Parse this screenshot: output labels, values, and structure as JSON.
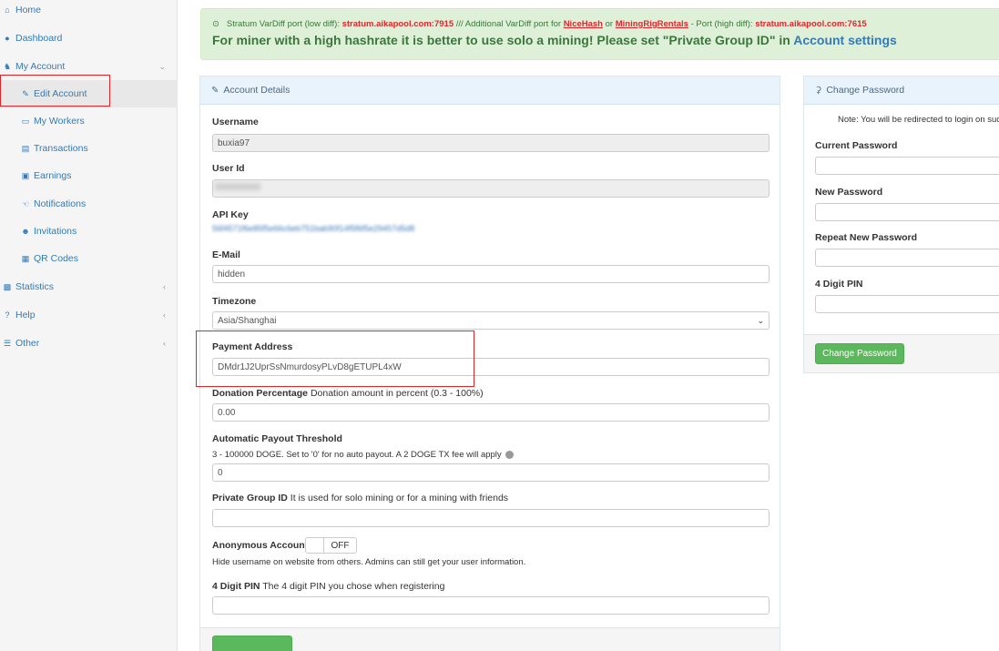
{
  "sidebar": {
    "home": "Home",
    "dashboard": "Dashboard",
    "my_account": "My Account",
    "edit_account": "Edit Account",
    "my_workers": "My Workers",
    "transactions": "Transactions",
    "earnings": "Earnings",
    "notifications": "Notifications",
    "invitations": "Invitations",
    "qr_codes": "QR Codes",
    "statistics": "Statistics",
    "help": "Help",
    "other": "Other"
  },
  "alert": {
    "line1_a": "Stratum VarDiff port (low diff): ",
    "port_low": "stratum.aikapool.com:7915",
    "line1_b": " /// Additional VarDiff port for ",
    "nicehash": "NiceHash",
    "or": " or ",
    "mrr": "MiningRigRentals",
    "line1_c": " - Port (high diff): ",
    "port_high": "stratum.aikapool.com:7615",
    "line2": "For miner with a high hashrate it is better to use solo a mining! Please set \"Private Group ID\" in ",
    "line2_link": "Account settings"
  },
  "account": {
    "title": "Account Details",
    "username_label": "Username",
    "username_value": "buxia97",
    "userid_label": "User Id",
    "apikey_label": "API Key",
    "apikey_value": "56f4571f6e85f5e66c6eb751bab90f14f5f6f5e29457d5d8",
    "email_label": "E-Mail",
    "email_value": "hidden",
    "timezone_label": "Timezone",
    "timezone_value": "Asia/Shanghai",
    "payment_label": "Payment Address",
    "payment_value": "DMdr1J2UprSsNmurdosyPLvD8gETUPL4xW",
    "donation_label": "Donation Percentage",
    "donation_hint": " Donation amount in percent (0.3 - 100%)",
    "donation_value": "0.00",
    "payout_label": "Automatic Payout Threshold",
    "payout_hint": "3 - 100000 DOGE. Set to '0' for no auto payout. A 2 DOGE TX fee will apply",
    "payout_value": "0",
    "group_label": "Private Group ID",
    "group_hint": " It is used for solo mining or for a mining with friends",
    "group_value": "",
    "anon_label": "Anonymous Account",
    "anon_toggle": "OFF",
    "anon_hint": "Hide username on website from others. Admins can still get your user information.",
    "pin_label": "4 Digit PIN",
    "pin_hint": " The 4 digit PIN you chose when registering",
    "pin_value": ""
  },
  "password": {
    "title": "Change Password",
    "note": "Note: You will be redirected to login on success.",
    "current_label": "Current Password",
    "new_label": "New Password",
    "repeat_label": "Repeat New Password",
    "pin_label": "4 Digit PIN",
    "button": "Change Password"
  }
}
